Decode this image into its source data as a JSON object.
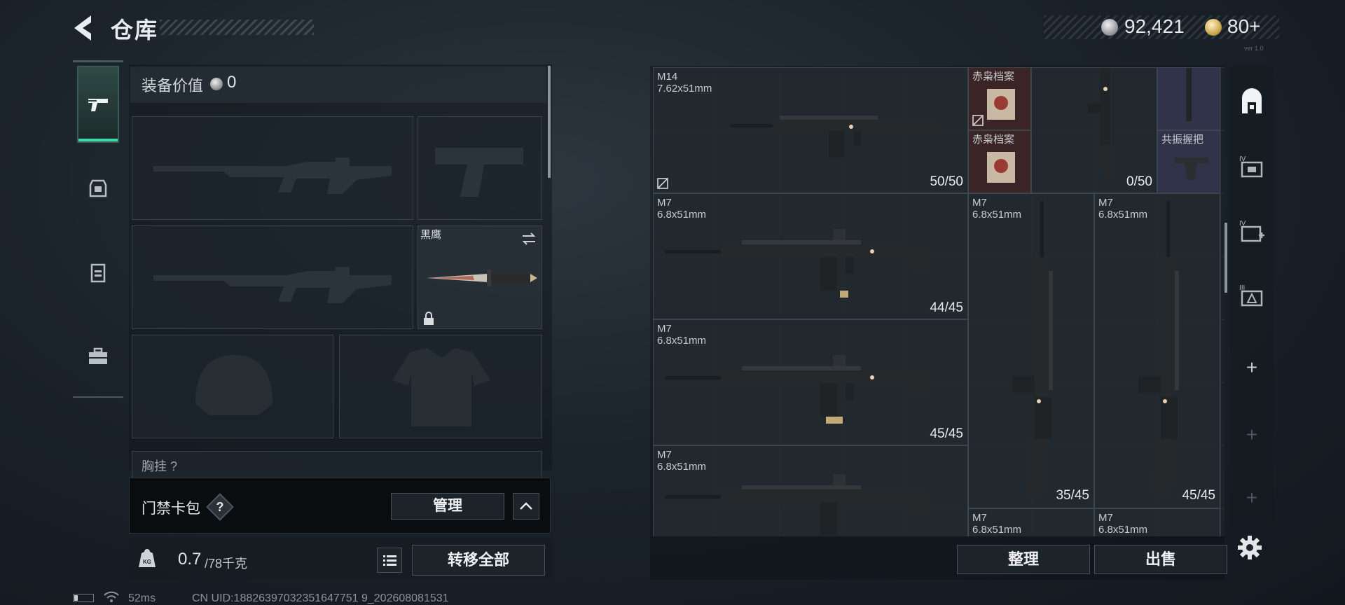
{
  "header": {
    "title": "仓库",
    "currency": {
      "silver": "92,421",
      "gold": "80+"
    },
    "version_mark": "ver 1.0"
  },
  "equipment": {
    "value_label": "装备价值",
    "value": "0",
    "knife_name": "黑鹰",
    "chest_label": "胸挂 ?"
  },
  "access_card": {
    "label": "门禁卡包",
    "help": "?",
    "manage_label": "管理"
  },
  "weight": {
    "current": "0.7",
    "max": "/78千克"
  },
  "transfer_all_label": "转移全部",
  "status": {
    "ping": "52ms",
    "uid": "CN UID:18826397032351647751 9_202608081531"
  },
  "stash": {
    "items": [
      {
        "name": "M14",
        "caliber": "7.62x51mm",
        "ammo": "50/50"
      },
      {
        "name": "赤枭档案",
        "caliber": "",
        "ammo": ""
      },
      {
        "name": "赤枭档案",
        "caliber": "",
        "ammo": ""
      },
      {
        "name": "",
        "caliber": "",
        "ammo": "0/50"
      },
      {
        "name": "共振握把",
        "caliber": "",
        "ammo": ""
      },
      {
        "name": "M7",
        "caliber": "6.8x51mm",
        "ammo": "44/45"
      },
      {
        "name": "M7",
        "caliber": "6.8x51mm",
        "ammo": "35/45"
      },
      {
        "name": "M7",
        "caliber": "6.8x51mm",
        "ammo": "45/45"
      },
      {
        "name": "M7",
        "caliber": "6.8x51mm",
        "ammo": "45/45"
      },
      {
        "name": "M7",
        "caliber": "6.8x51mm",
        "ammo": ""
      },
      {
        "name": "M7",
        "caliber": "6.8x51mm",
        "ammo": ""
      },
      {
        "name": "M7",
        "caliber": "6.8x51mm",
        "ammo": ""
      }
    ],
    "sort_label": "整理",
    "sell_label": "出售"
  },
  "right_rail": {
    "tier_labels": [
      "IV",
      "IV",
      "III"
    ],
    "plus": "+"
  },
  "colors": {
    "accent": "#3fd9a8",
    "panel": "#1a2127",
    "button": "#1c2329"
  }
}
